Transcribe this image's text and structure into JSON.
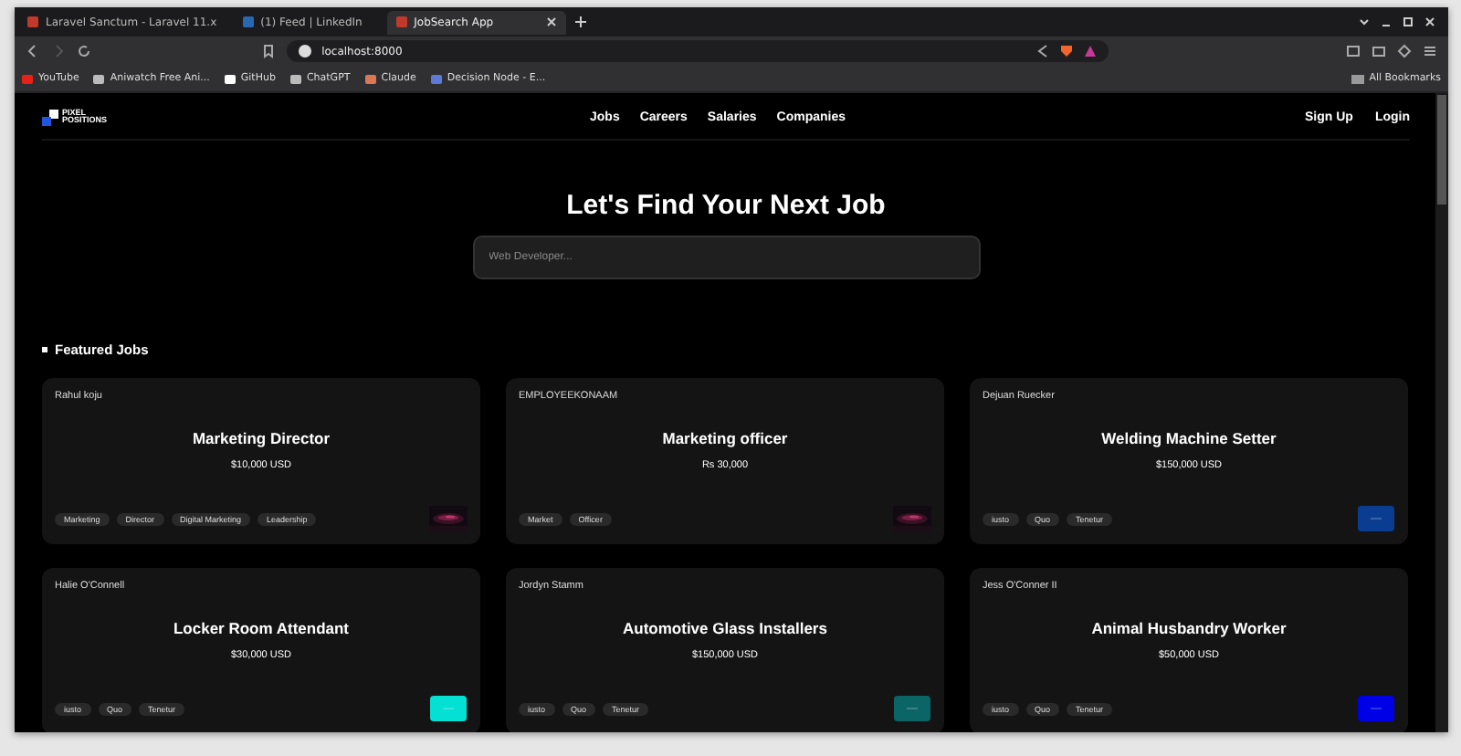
{
  "browser": {
    "tabs": [
      {
        "title": "Laravel Sanctum - Laravel 11.x",
        "selected": false,
        "color": "#c0392b"
      },
      {
        "title": "(1) Feed | LinkedIn",
        "selected": false,
        "color": "#2867b2"
      },
      {
        "title": "JobSearch App",
        "selected": true,
        "color": "#c0392b"
      }
    ],
    "address": "localhost:8000",
    "bookmarks": [
      {
        "label": "YouTube",
        "color": "#e62117"
      },
      {
        "label": "Aniwatch Free Ani...",
        "color": "#bbbbbb"
      },
      {
        "label": "GitHub",
        "color": "#ffffff"
      },
      {
        "label": "ChatGPT",
        "color": "#bbbbbb"
      },
      {
        "label": "Claude",
        "color": "#d97757"
      },
      {
        "label": "Decision Node - E...",
        "color": "#5b7bd6"
      }
    ],
    "all_bookmarks": "All Bookmarks"
  },
  "site": {
    "logo": [
      "PIXEL",
      "POSITIONS"
    ],
    "nav": [
      "Jobs",
      "Careers",
      "Salaries",
      "Companies"
    ],
    "auth": [
      "Sign Up",
      "Login"
    ],
    "heading": "Let's Find Your Next Job",
    "search": {
      "placeholder": "Web Developer..."
    },
    "section_title": "Featured Jobs",
    "jobs": [
      {
        "employer": "Rahul koju",
        "title": "Marketing Director",
        "salary": "$10,000 USD",
        "tags": [
          "Marketing",
          "Director",
          "Digital Marketing",
          "Leadership"
        ],
        "logo": {
          "kind": "picture"
        }
      },
      {
        "employer": "EMPLOYEEKONAAM",
        "title": "Marketing officer",
        "salary": "Rs 30,000",
        "tags": [
          "Market",
          "Officer"
        ],
        "logo": {
          "kind": "picture"
        }
      },
      {
        "employer": "Dejuan Ruecker",
        "title": "Welding Machine Setter",
        "salary": "$150,000 USD",
        "tags": [
          "iusto",
          "Quo",
          "Tenetur"
        ],
        "logo": {
          "kind": "swatch",
          "color": "#0a3d91"
        }
      },
      {
        "employer": "Halie O'Connell",
        "title": "Locker Room Attendant",
        "salary": "$30,000 USD",
        "tags": [
          "iusto",
          "Quo",
          "Tenetur"
        ],
        "logo": {
          "kind": "swatch",
          "color": "#05e0d4"
        }
      },
      {
        "employer": "Jordyn Stamm",
        "title": "Automotive Glass Installers",
        "salary": "$150,000 USD",
        "tags": [
          "iusto",
          "Quo",
          "Tenetur"
        ],
        "logo": {
          "kind": "swatch",
          "color": "#0b6466"
        }
      },
      {
        "employer": "Jess O'Conner II",
        "title": "Animal Husbandry Worker",
        "salary": "$50,000 USD",
        "tags": [
          "iusto",
          "Quo",
          "Tenetur"
        ],
        "logo": {
          "kind": "swatch",
          "color": "#0000e6"
        }
      }
    ]
  }
}
